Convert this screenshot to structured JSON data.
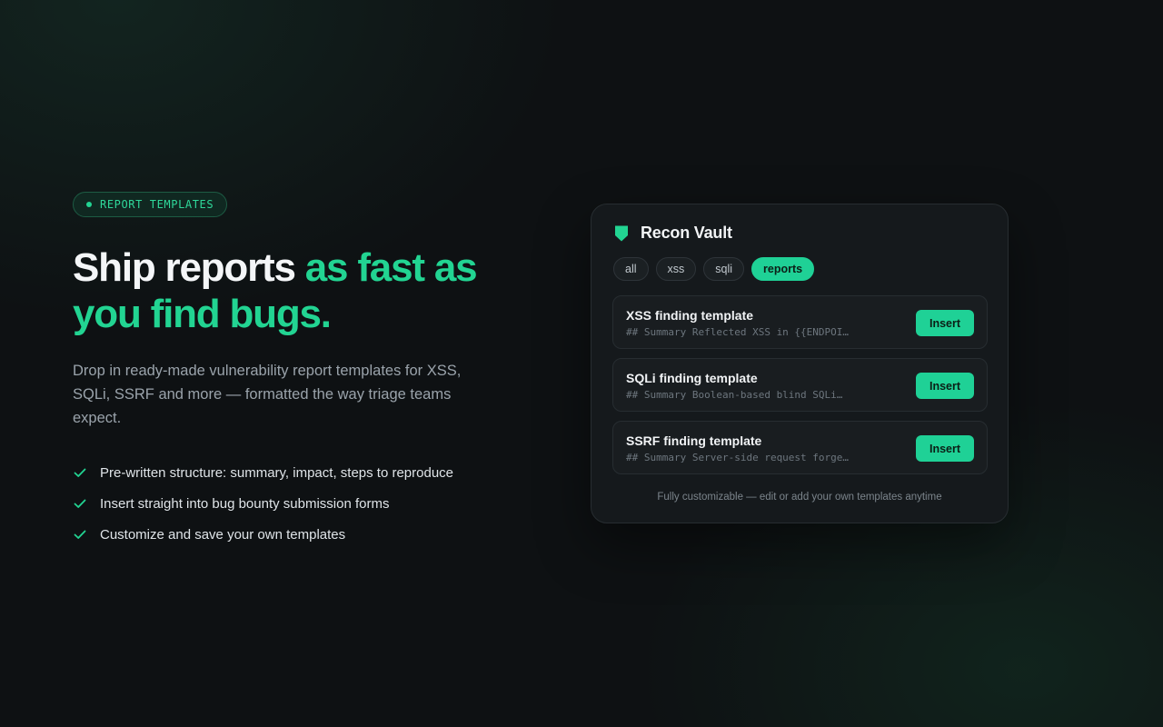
{
  "badge": {
    "label": "REPORT TEMPLATES"
  },
  "headline": {
    "line1_plain": "Ship reports ",
    "line1_accent": "as fast as",
    "line2_accent": "you find bugs."
  },
  "lead": "Drop in ready-made vulnerability report templates for XSS, SQLi, SSRF and more — formatted the way triage teams expect.",
  "features": [
    "Pre-written structure: summary, impact, steps to reproduce",
    "Insert straight into bug bounty submission forms",
    "Customize and save your own templates"
  ],
  "card": {
    "title": "Recon Vault",
    "icon": "shield-icon",
    "filters": [
      {
        "label": "all",
        "active": false
      },
      {
        "label": "xss",
        "active": false
      },
      {
        "label": "sqli",
        "active": false
      },
      {
        "label": "reports",
        "active": true
      }
    ],
    "templates": [
      {
        "name": "XSS finding template",
        "preview": "## Summary Reflected XSS in {{ENDPOI…",
        "action": "Insert"
      },
      {
        "name": "SQLi finding template",
        "preview": "## Summary Boolean-based blind SQLi…",
        "action": "Insert"
      },
      {
        "name": "SSRF finding template",
        "preview": "## Summary Server-side request forge…",
        "action": "Insert"
      }
    ],
    "footer": "Fully customizable — edit or add your own templates anytime"
  },
  "colors": {
    "accent": "#22d492",
    "background": "#0e1113",
    "card": "#15191c"
  }
}
